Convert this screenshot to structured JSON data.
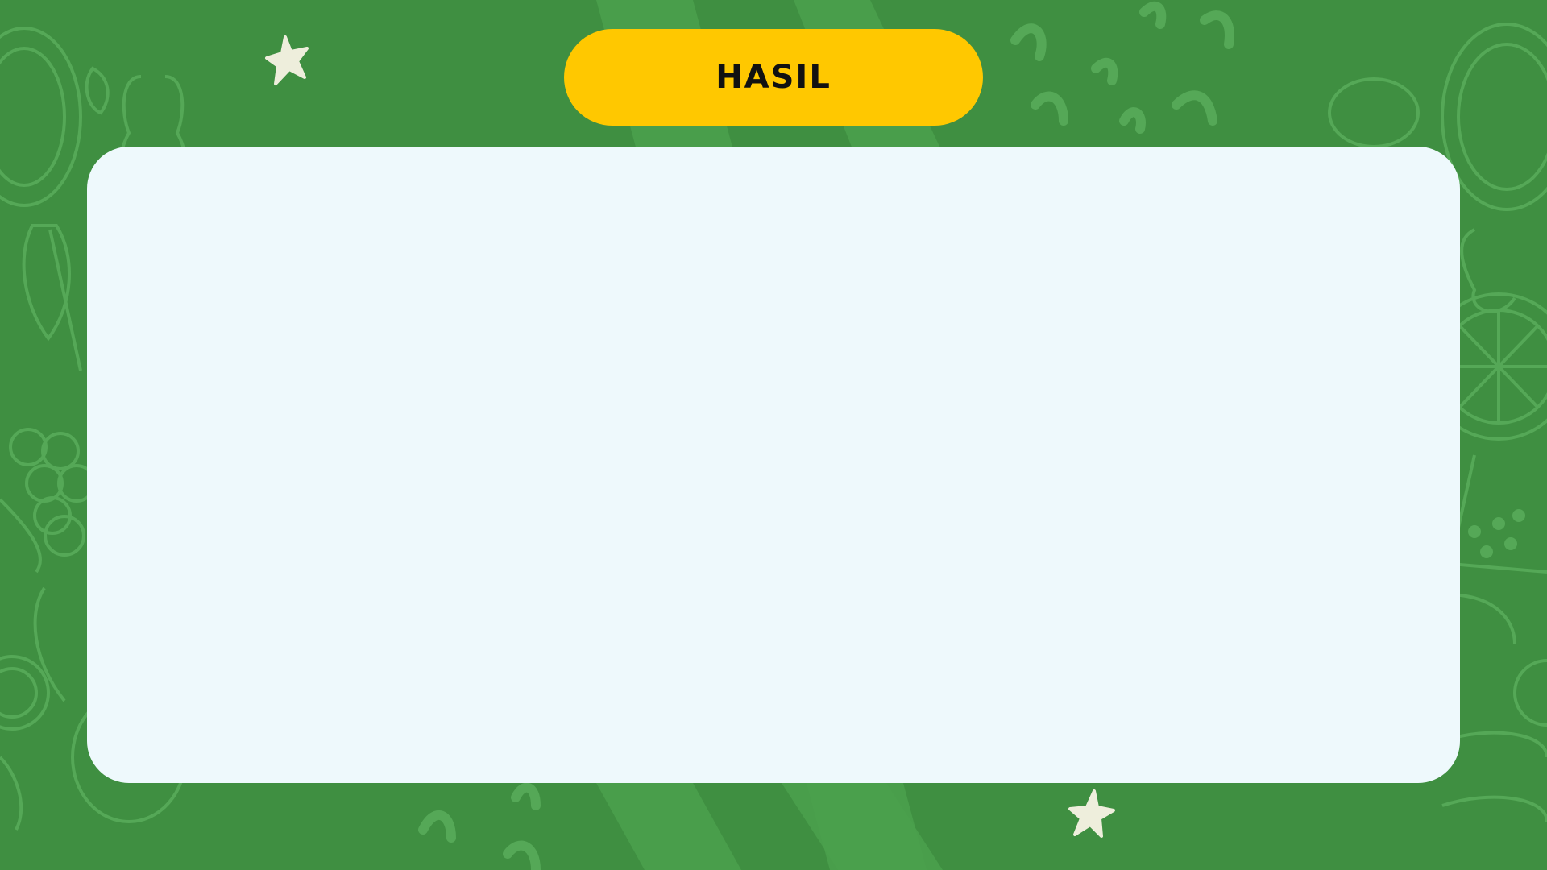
{
  "slide": {
    "title": "HASIL"
  },
  "colors": {
    "background": "#3f8f41",
    "pattern": "#4aa04c",
    "pattern_stroke": "#55a857",
    "title_pill": "#ffc800",
    "card": "#eef9fc",
    "star": "#eeeedc",
    "title_text": "#111111"
  },
  "icons": {
    "decor_left": "fruit-pattern-icon",
    "star_top": "star-icon",
    "star_bottom": "star-icon"
  }
}
